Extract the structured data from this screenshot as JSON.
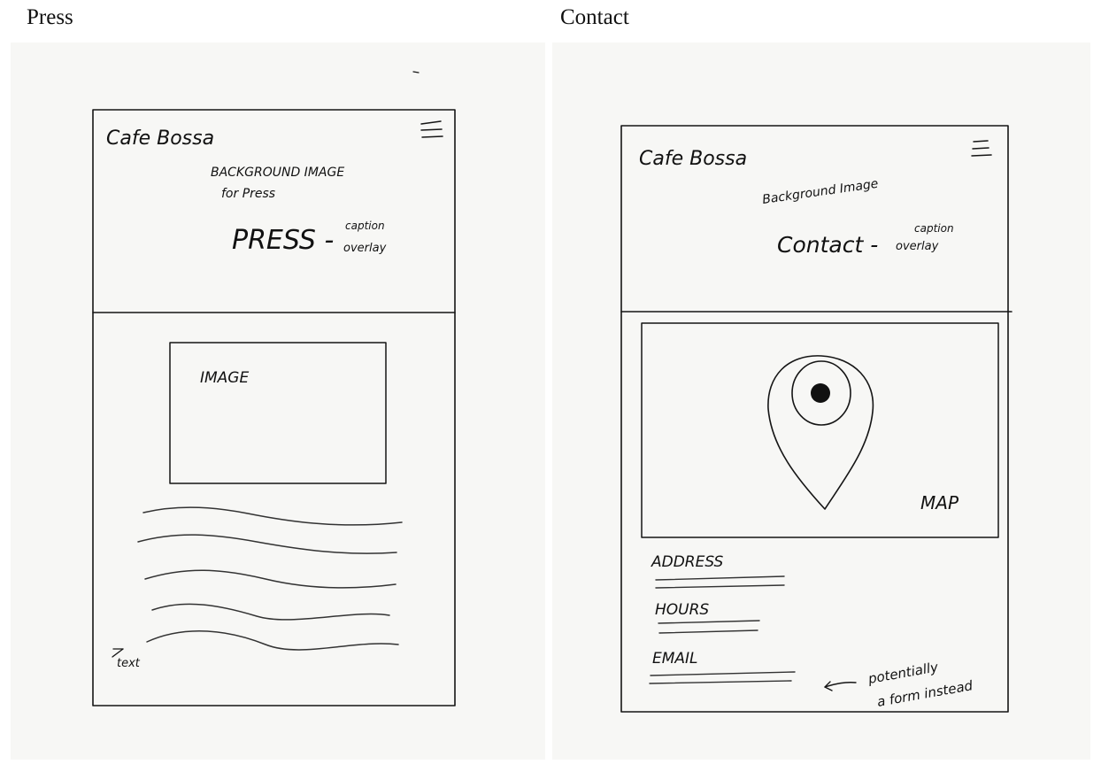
{
  "labels": {
    "press": "Press",
    "contact": "Contact"
  },
  "press": {
    "logo": "Cafe Bossa",
    "hero_line1": "BACKGROUND IMAGE",
    "hero_line2": "for Press",
    "caption_title": "PRESS -",
    "caption_note_1": "caption",
    "caption_note_2": "overlay",
    "image_label": "IMAGE",
    "text_note": "text"
  },
  "contact": {
    "logo": "Cafe Bossa",
    "hero_line": "Background Image",
    "caption_title": "Contact -",
    "caption_note_1": "caption",
    "caption_note_2": "overlay",
    "map_label": "MAP",
    "address_label": "ADDRESS",
    "hours_label": "HOURS",
    "email_label": "EMAIL",
    "form_note_1": "potentially",
    "form_note_2": "a form instead"
  }
}
